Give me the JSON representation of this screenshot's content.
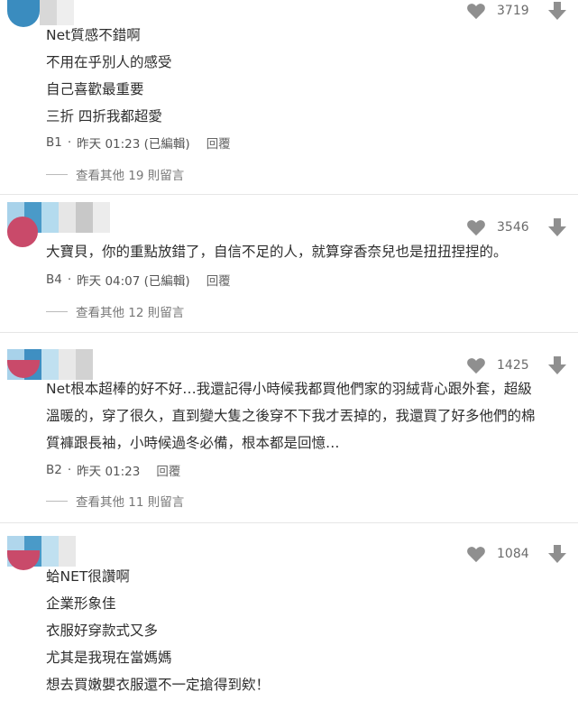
{
  "colors": {
    "avatar_pink": "#c94a6a",
    "blur_blue": "#4a9ac8",
    "icon_gray": "#8f8f8f"
  },
  "comments": [
    {
      "votes": "3719",
      "lines": [
        "Net質感不錯啊",
        "不用在乎別人的感受",
        "自己喜歡最重要",
        "三折 四折我都超愛"
      ],
      "floor": "B1",
      "time": "昨天 01:23 (已編輯)",
      "reply": "回覆",
      "more": "查看其他 19 則留言"
    },
    {
      "votes": "3546",
      "lines": [
        "大寶貝，你的重點放錯了，自信不足的人，就算穿香奈兒也是扭扭捏捏的。"
      ],
      "floor": "B4",
      "time": "昨天 04:07 (已編輯)",
      "reply": "回覆",
      "more": "查看其他 12 則留言"
    },
    {
      "votes": "1425",
      "lines": [
        "Net根本超棒的好不好…我還記得小時候我都買他們家的羽絨背心跟外套，超級",
        "溫暖的，穿了很久，直到變大隻之後穿不下我才丟掉的，我還買了好多他們的棉",
        "質褲跟長袖，小時候過冬必備，根本都是回憶…"
      ],
      "floor": "B2",
      "time": "昨天 01:23",
      "reply": "回覆",
      "more": "查看其他 11 則留言"
    },
    {
      "votes": "1084",
      "lines": [
        "蛤NET很讚啊",
        "企業形象佳",
        "衣服好穿款式又多",
        "尤其是我現在當媽媽",
        "想去買嫩嬰衣服還不一定搶得到欸！"
      ]
    }
  ]
}
